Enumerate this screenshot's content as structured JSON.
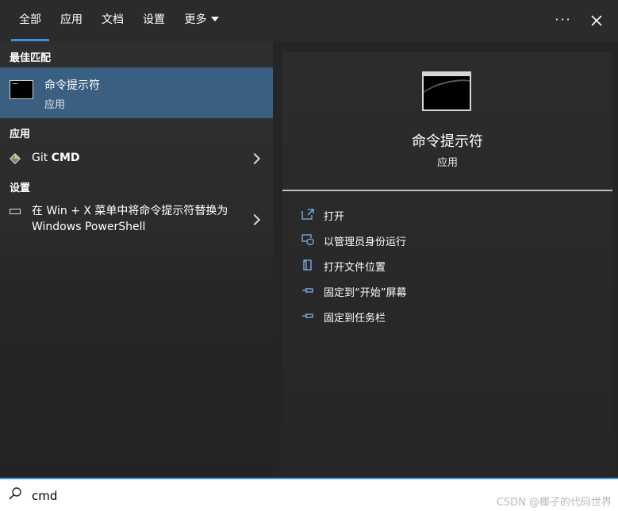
{
  "tabs": [
    {
      "label": "全部",
      "active": true
    },
    {
      "label": "应用",
      "active": false
    },
    {
      "label": "文档",
      "active": false
    },
    {
      "label": "设置",
      "active": false
    },
    {
      "label": "更多",
      "active": false
    }
  ],
  "topbar": {
    "more_icon": "ellipsis-icon",
    "close_icon": "close-icon"
  },
  "left": {
    "best_match_title": "最佳匹配",
    "best_match": {
      "title": "命令提示符",
      "subtitle": "应用",
      "icon": "cmd-icon"
    },
    "apps_title": "应用",
    "apps": [
      {
        "label_plain": "Git ",
        "label_bold": "CMD",
        "icon": "git-icon"
      }
    ],
    "settings_title": "设置",
    "settings": [
      {
        "text": "在 Win + X 菜单中将命令提示符替换为 Windows PowerShell",
        "icon": "settings-panel-icon"
      }
    ]
  },
  "right": {
    "title": "命令提示符",
    "subtitle": "应用",
    "actions": [
      {
        "label": "打开",
        "icon": "open-icon"
      },
      {
        "label": "以管理员身份运行",
        "icon": "shield-icon"
      },
      {
        "label": "打开文件位置",
        "icon": "folder-icon"
      },
      {
        "label": "固定到“开始”屏幕",
        "icon": "pin-icon"
      },
      {
        "label": "固定到任务栏",
        "icon": "pin-icon"
      }
    ]
  },
  "search": {
    "value": "cmd",
    "icon": "search-icon"
  },
  "watermark": "CSDN @椰子的代码世界",
  "colors": {
    "accent": "#3a8ee6",
    "selected": "#3a5f80"
  }
}
